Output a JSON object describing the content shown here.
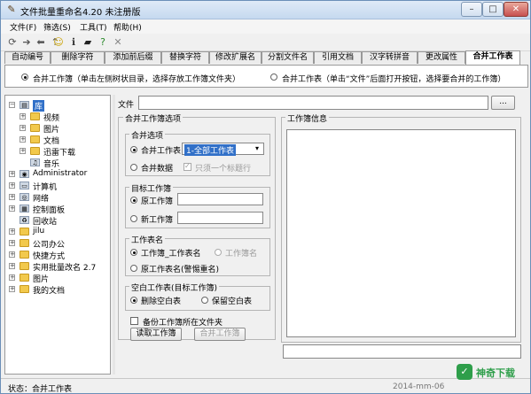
{
  "window": {
    "title": "文件批量重命名4.20 未注册版"
  },
  "menu": [
    "文件(F)",
    "筛选(S)",
    "工具(T)",
    "帮助(H)"
  ],
  "tabs": [
    "自动编号",
    "删除字符",
    "添加前后缀",
    "替换字符",
    "修改扩展名",
    "分割文件名",
    "引用文档",
    "汉字转拼音",
    "更改属性",
    "合并工作表"
  ],
  "mode": {
    "option1": "合并工作簿（单击左侧树状目录，选择存放工作簿文件夹）",
    "option2": "合并工作表（单击“文件”后面打开按钮，选择要合并的工作簿）"
  },
  "file_row": {
    "label": "文件",
    "browse_button": "..."
  },
  "tree": [
    {
      "label": "库",
      "level": 0,
      "icon": "library",
      "selected": true
    },
    {
      "label": "视频",
      "level": 1,
      "icon": "folder"
    },
    {
      "label": "图片",
      "level": 1,
      "icon": "folder"
    },
    {
      "label": "文档",
      "level": 1,
      "icon": "folder"
    },
    {
      "label": "迅雷下载",
      "level": 1,
      "icon": "folder"
    },
    {
      "label": "音乐",
      "level": 1,
      "icon": "music"
    },
    {
      "label": "Administrator",
      "level": 0,
      "icon": "user"
    },
    {
      "label": "计算机",
      "level": 0,
      "icon": "computer"
    },
    {
      "label": "网络",
      "level": 0,
      "icon": "network"
    },
    {
      "label": "控制面板",
      "level": 0,
      "icon": "control-panel"
    },
    {
      "label": "回收站",
      "level": 0,
      "icon": "recycle-bin"
    },
    {
      "label": "jilu",
      "level": 0,
      "icon": "folder"
    },
    {
      "label": "公司办公",
      "level": 0,
      "icon": "folder"
    },
    {
      "label": "快捷方式",
      "level": 0,
      "icon": "folder"
    },
    {
      "label": "实用批量改名 2.7",
      "level": 0,
      "icon": "folder"
    },
    {
      "label": "图片",
      "level": 0,
      "icon": "folder"
    },
    {
      "label": "我的文档",
      "level": 0,
      "icon": "folder"
    }
  ],
  "options_panel": {
    "title": "合并工作簿选项",
    "merge_group": {
      "title": "合并选项",
      "merge_sheets": "合并工作表",
      "sheet_combo": "1-全部工作表",
      "merge_data": "合并数据",
      "single_header": "只须一个标题行"
    },
    "target_group": {
      "title": "目标工作簿",
      "original": "原工作簿",
      "original_value": "",
      "new": "新工作簿",
      "new_value": ""
    },
    "sheetname_group": {
      "title": "工作表名",
      "workbook_sheet": "工作簿_工作表名",
      "workbook_name": "工作簿名",
      "original_sheet": "原工作表名(警惕重名)"
    },
    "blank_group": {
      "title": "空白工作表(目标工作簿)",
      "delete": "删除空白表",
      "keep": "保留空白表"
    },
    "backup": "备份工作簿所在文件夹",
    "read_button": "读取工作簿",
    "merge_button": "合并工作簿"
  },
  "info_panel": {
    "title": "工作簿信息"
  },
  "status": {
    "text": "状态：合并工作表",
    "date": "2014-mm-06"
  },
  "watermark": "神奇下载"
}
